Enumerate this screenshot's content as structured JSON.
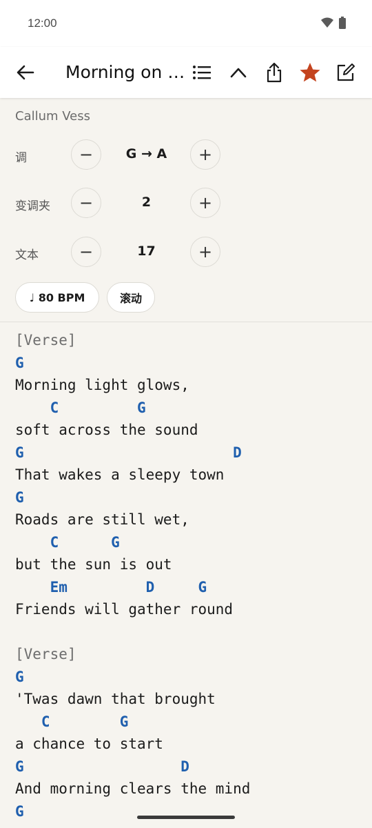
{
  "status": {
    "time": "12:00"
  },
  "toolbar": {
    "title": "Morning on the Harbour",
    "star_color": "#c4441f"
  },
  "controls": {
    "artist": "Callum Vess",
    "key": {
      "label": "调",
      "value": "G → A"
    },
    "capo": {
      "label": "变调夹",
      "value": "2"
    },
    "text": {
      "label": "文本",
      "value": "17"
    },
    "minus": "−",
    "plus": "+",
    "bpm_label": "♩ 80 BPM",
    "scroll_label": "滚动"
  },
  "sheet": {
    "chord_color": "#1f5fae",
    "lines": [
      {
        "type": "section",
        "text": "[Verse]"
      },
      {
        "type": "chords",
        "text": "G"
      },
      {
        "type": "lyric",
        "text": "Morning light glows,"
      },
      {
        "type": "chords",
        "text": "    C         G"
      },
      {
        "type": "lyric",
        "text": "soft across the sound"
      },
      {
        "type": "chords",
        "text": "G                        D"
      },
      {
        "type": "lyric",
        "text": "That wakes a sleepy town"
      },
      {
        "type": "chords",
        "text": "G"
      },
      {
        "type": "lyric",
        "text": "Roads are still wet,"
      },
      {
        "type": "chords",
        "text": "    C      G"
      },
      {
        "type": "lyric",
        "text": "but the sun is out"
      },
      {
        "type": "chords",
        "text": "    Em         D     G"
      },
      {
        "type": "lyric",
        "text": "Friends will gather round"
      },
      {
        "type": "blank",
        "text": ""
      },
      {
        "type": "section",
        "text": "[Verse]"
      },
      {
        "type": "chords",
        "text": "G"
      },
      {
        "type": "lyric",
        "text": "'Twas dawn that brought"
      },
      {
        "type": "chords",
        "text": "   C        G"
      },
      {
        "type": "lyric",
        "text": "a chance to start"
      },
      {
        "type": "chords",
        "text": "G                  D"
      },
      {
        "type": "lyric",
        "text": "And morning clears the mind"
      },
      {
        "type": "chords",
        "text": "G"
      }
    ]
  }
}
